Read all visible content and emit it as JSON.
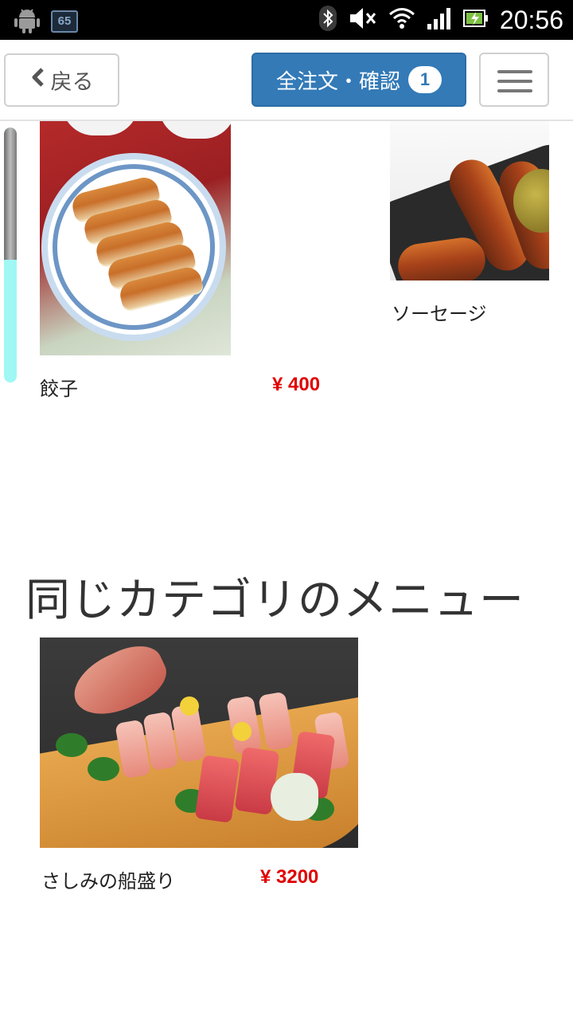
{
  "status_bar": {
    "notification_badge": "65",
    "time": "20:56",
    "icons": [
      "android-icon",
      "bluetooth-icon",
      "mute-icon",
      "wifi-icon",
      "signal-icon",
      "battery-icon"
    ]
  },
  "nav": {
    "back_label": "戻る",
    "order_label": "全注文・確認",
    "order_count": "1",
    "colors": {
      "primary": "#337ab7",
      "price": "#e00000"
    }
  },
  "scroll": {
    "position_fraction": 0.52
  },
  "items": [
    {
      "name": "餃子",
      "price": "¥ 400"
    },
    {
      "name": "ソーセージ"
    }
  ],
  "related": {
    "title": "同じカテゴリのメニュー",
    "items": [
      {
        "name": "さしみの船盛り",
        "price": "¥ 3200"
      }
    ]
  }
}
